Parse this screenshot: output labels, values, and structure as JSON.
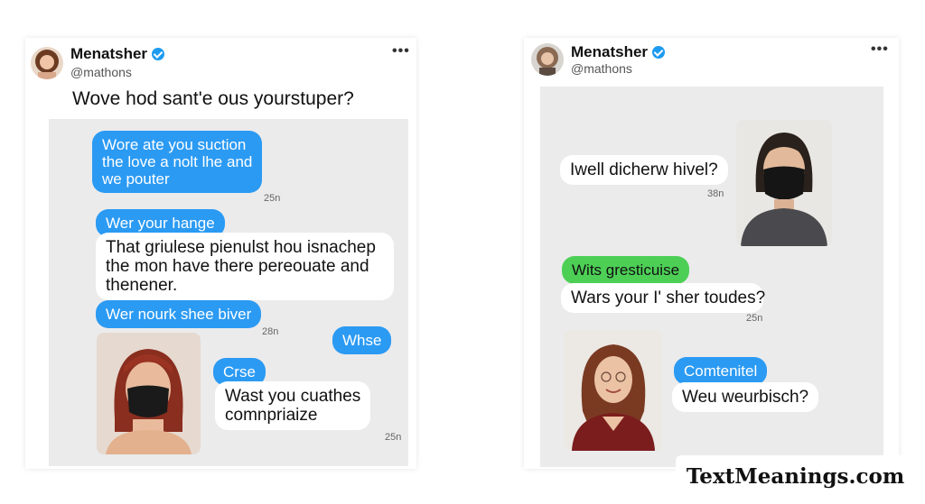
{
  "left_card": {
    "user_name": "Menatsher",
    "handle": "@mathons",
    "more_label": "•••",
    "tweet_text": "Wove hod sant'e ous yourstuper?",
    "messages": [
      {
        "text": "Wore ate you suction\nthe love a nolt lhe and\nwe pouter",
        "style": "blue"
      },
      {
        "time": "25n"
      },
      {
        "text": "Wer your hange",
        "style": "blue"
      },
      {
        "text": "That griulese pienulst hou isnachep\nthe mon have there pereouate and\nthenener.",
        "style": "white"
      },
      {
        "text": "Wer nourk shee biver",
        "style": "blue"
      },
      {
        "time": "28n"
      },
      {
        "text": "Whse",
        "style": "blue"
      },
      {
        "text": "Crse",
        "style": "blue"
      },
      {
        "text": "Wast you cuathes\ncomnpriaize",
        "style": "white"
      },
      {
        "time": "25n"
      }
    ]
  },
  "right_card": {
    "user_name": "Menatsher",
    "handle": "@mathons",
    "more_label": "•••",
    "messages": [
      {
        "text": "Iwell dicherw hivel?",
        "style": "white"
      },
      {
        "time": "38n"
      },
      {
        "text": "Wits gresticuise",
        "style": "green"
      },
      {
        "text": "Wars your I' sher toudes?",
        "style": "white"
      },
      {
        "time": "25n"
      },
      {
        "text": "Comtenitel",
        "style": "blue"
      },
      {
        "text": "Weu weurbisch?",
        "style": "white"
      }
    ]
  },
  "watermark": "TextMeanings.com",
  "colors": {
    "blue_bubble": "#2b9af3",
    "green_bubble": "#4dcf56",
    "verified": "#1d9bf0",
    "chat_bg": "#ebebec"
  }
}
